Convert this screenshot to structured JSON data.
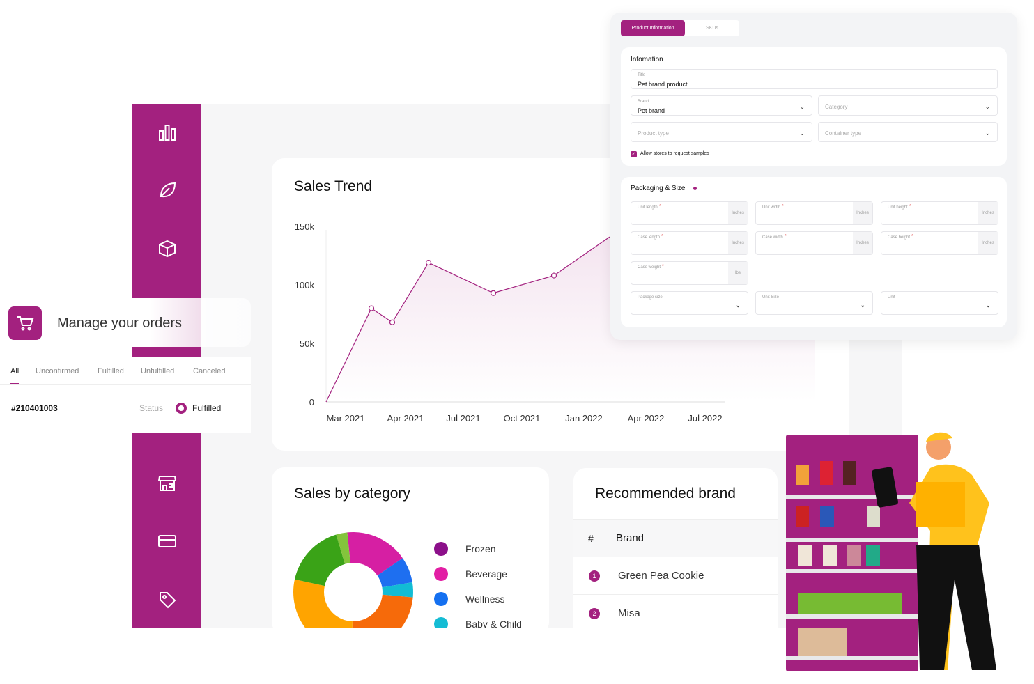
{
  "colors": {
    "brand": "#a3217f"
  },
  "sidebar": {
    "icons": [
      "bar-chart-icon",
      "leaf-icon",
      "box-icon",
      "store-icon",
      "credit-card-icon",
      "tag-icon"
    ]
  },
  "orders": {
    "title": "Manage your orders",
    "tabs": [
      "All",
      "Unconfirmed",
      "Fulfilled",
      "Unfulfilled",
      "Canceled"
    ],
    "active_tab": "All",
    "order_id": "#210401003",
    "status_label": "Status",
    "status_value": "Fulfilled"
  },
  "product_form": {
    "tabs": [
      "Product Information",
      "SKUs"
    ],
    "active_tab": "Product Information",
    "info_heading": "Infomation",
    "title_label": "Title",
    "title_value": "Pet brand product",
    "brand_label": "Brand",
    "brand_value": "Pet brand",
    "category_placeholder": "Category",
    "product_type_placeholder": "Product type",
    "container_type_placeholder": "Container type",
    "allow_samples_label": "Allow stores to request samples",
    "allow_samples_checked": true,
    "packaging_heading": "Packaging & Size",
    "dim_fields": [
      {
        "label": "Unit length",
        "unit": "Inches"
      },
      {
        "label": "Unit width",
        "unit": "Inches"
      },
      {
        "label": "Unit height",
        "unit": "Inches"
      },
      {
        "label": "Case length",
        "unit": "Inches"
      },
      {
        "label": "Case width",
        "unit": "Inches"
      },
      {
        "label": "Case height",
        "unit": "Inches"
      },
      {
        "label": "Case weight",
        "unit": "lbs"
      }
    ],
    "select_fields": [
      "Package size",
      "Unit Size",
      "Unit"
    ],
    "required_mark": "*"
  },
  "chart_data": [
    {
      "type": "area",
      "title": "Sales Trend",
      "categories": [
        "Mar 2021",
        "Apr 2021",
        "Jul 2021",
        "Oct 2021",
        "Jan 2022",
        "Apr 2022",
        "Jul 2022"
      ],
      "yticks": [
        "0",
        "50k",
        "100k",
        "150k"
      ],
      "ylim": [
        0,
        150000
      ],
      "points": [
        0,
        80000,
        68000,
        119000,
        93000,
        108000,
        141000
      ]
    },
    {
      "type": "pie",
      "title": "Sales by category",
      "legend": [
        "Frozen",
        "Beverage",
        "Wellness",
        "Baby & Child"
      ],
      "slices": [
        {
          "color": "#d61fa3",
          "value": 17
        },
        {
          "color": "#1e6ff0",
          "value": 7
        },
        {
          "color": "#12bcd4",
          "value": 4
        },
        {
          "color": "#f66a0a",
          "value": 24
        },
        {
          "color": "#ffa400",
          "value": 28
        },
        {
          "color": "#3aa317",
          "value": 17
        },
        {
          "color": "#84c43c",
          "value": 3
        }
      ],
      "legend_colors": [
        "#8c108a",
        "#e21ea4",
        "#1470f0",
        "#14bcd4"
      ]
    }
  ],
  "brands": {
    "title": "Recommended brand",
    "col_num": "#",
    "col_brand": "Brand",
    "rows": [
      {
        "n": "1",
        "name": "Green Pea Cookie"
      },
      {
        "n": "2",
        "name": "Misa"
      }
    ]
  }
}
